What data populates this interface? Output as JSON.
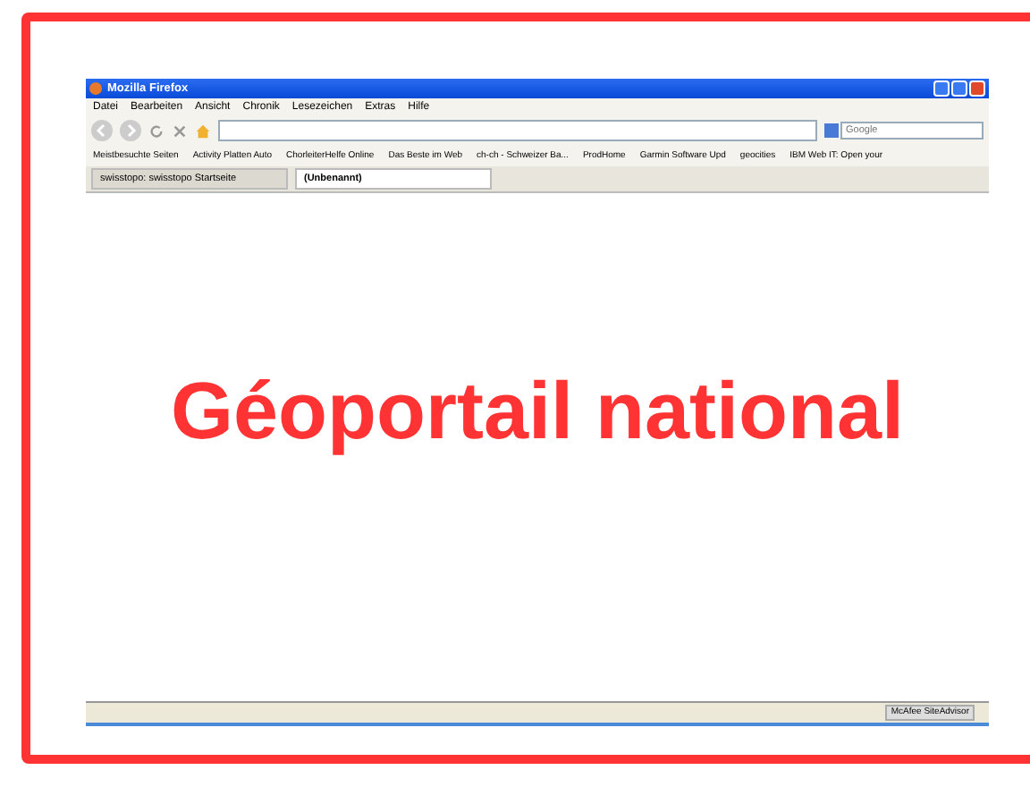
{
  "window": {
    "title": "Mozilla Firefox"
  },
  "menu": [
    "Datei",
    "Bearbeiten",
    "Ansicht",
    "Chronik",
    "Lesezeichen",
    "Extras",
    "Hilfe"
  ],
  "search": {
    "placeholder": "Google"
  },
  "bookmarks": [
    "Meistbesuchte Seiten",
    "Activity Platten Auto",
    "ChorleiterHelfe Online",
    "Das Beste im Web",
    "ch-ch - Schweizer Ba...",
    "ProdHome",
    "Garmin Software Upd",
    "geocities",
    "IBM Web IT: Open your"
  ],
  "tabs": [
    {
      "label": "swisstopo: swisstopo Startseite",
      "selected": false
    },
    {
      "label": "(Unbenannt)",
      "selected": true
    }
  ],
  "overlay_title": "Géoportail national",
  "status_bar": {
    "addon": "McAfee SiteAdvisor"
  }
}
